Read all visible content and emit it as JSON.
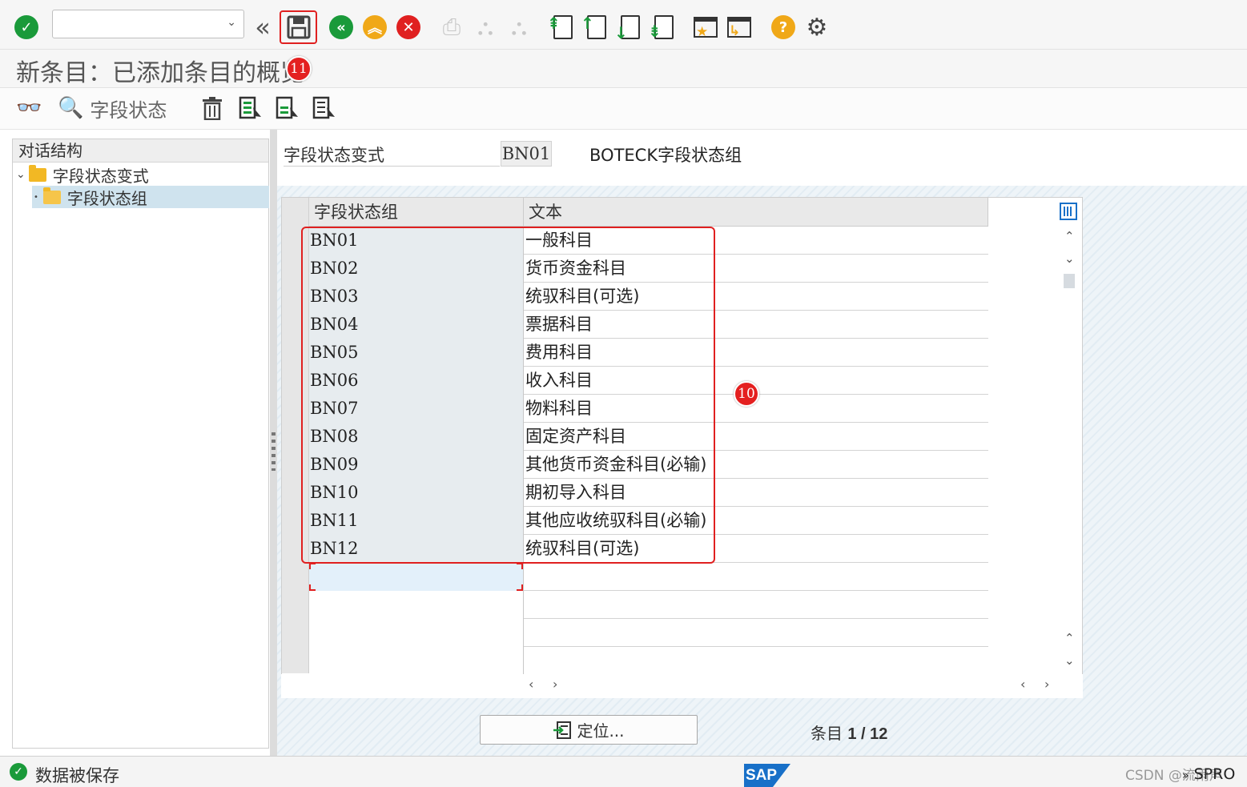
{
  "toolbar": {
    "command_field_value": "",
    "icons": [
      "enter-check-icon",
      "back-icon",
      "save-icon",
      "exit-icon",
      "up-icon",
      "cancel-icon",
      "print-icon",
      "find-icon",
      "find-next-icon",
      "first-page-icon",
      "prev-page-icon",
      "next-page-icon",
      "last-page-icon",
      "create-session-icon",
      "shortcut-icon",
      "help-icon",
      "settings-icon"
    ]
  },
  "title": "新条目：已添加条目的概览",
  "app_toolbar": {
    "field_status_label": "字段状态"
  },
  "annotations": {
    "badge_save": "11",
    "badge_table": "10"
  },
  "tree": {
    "header": "对话结构",
    "items": [
      {
        "label": "字段状态变式"
      },
      {
        "label": "字段状态组"
      }
    ]
  },
  "header_fields": {
    "fsv_label": "字段状态变式",
    "fsv_value": "BN01",
    "fsv_desc": "BOTECK字段状态组"
  },
  "table": {
    "columns": [
      "字段状态组",
      "文本"
    ],
    "rows": [
      {
        "key": "BN01",
        "text": "一般科目"
      },
      {
        "key": "BN02",
        "text": "货币资金科目"
      },
      {
        "key": "BN03",
        "text": "统驭科目(可选)"
      },
      {
        "key": "BN04",
        "text": "票据科目"
      },
      {
        "key": "BN05",
        "text": "费用科目"
      },
      {
        "key": "BN06",
        "text": "收入科目"
      },
      {
        "key": "BN07",
        "text": "物料科目"
      },
      {
        "key": "BN08",
        "text": "固定资产科目"
      },
      {
        "key": "BN09",
        "text": "其他货币资金科目(必输)"
      },
      {
        "key": "BN10",
        "text": "期初导入科目"
      },
      {
        "key": "BN11",
        "text": "其他应收统驭科目(必输)"
      },
      {
        "key": "BN12",
        "text": "统驭科目(可选)"
      }
    ]
  },
  "footer": {
    "locate_label": "定位...",
    "entry_prefix": "条目",
    "entry_count": "1 / 12"
  },
  "status": {
    "message": "数据被保存",
    "sap": "SAP",
    "watermark": "CSDN @流雨声",
    "tcode": "SPRO"
  },
  "colors": {
    "accent_green": "#1a9a3a",
    "accent_orange": "#f0a818",
    "accent_red": "#e02020",
    "sap_blue": "#1870c8"
  }
}
